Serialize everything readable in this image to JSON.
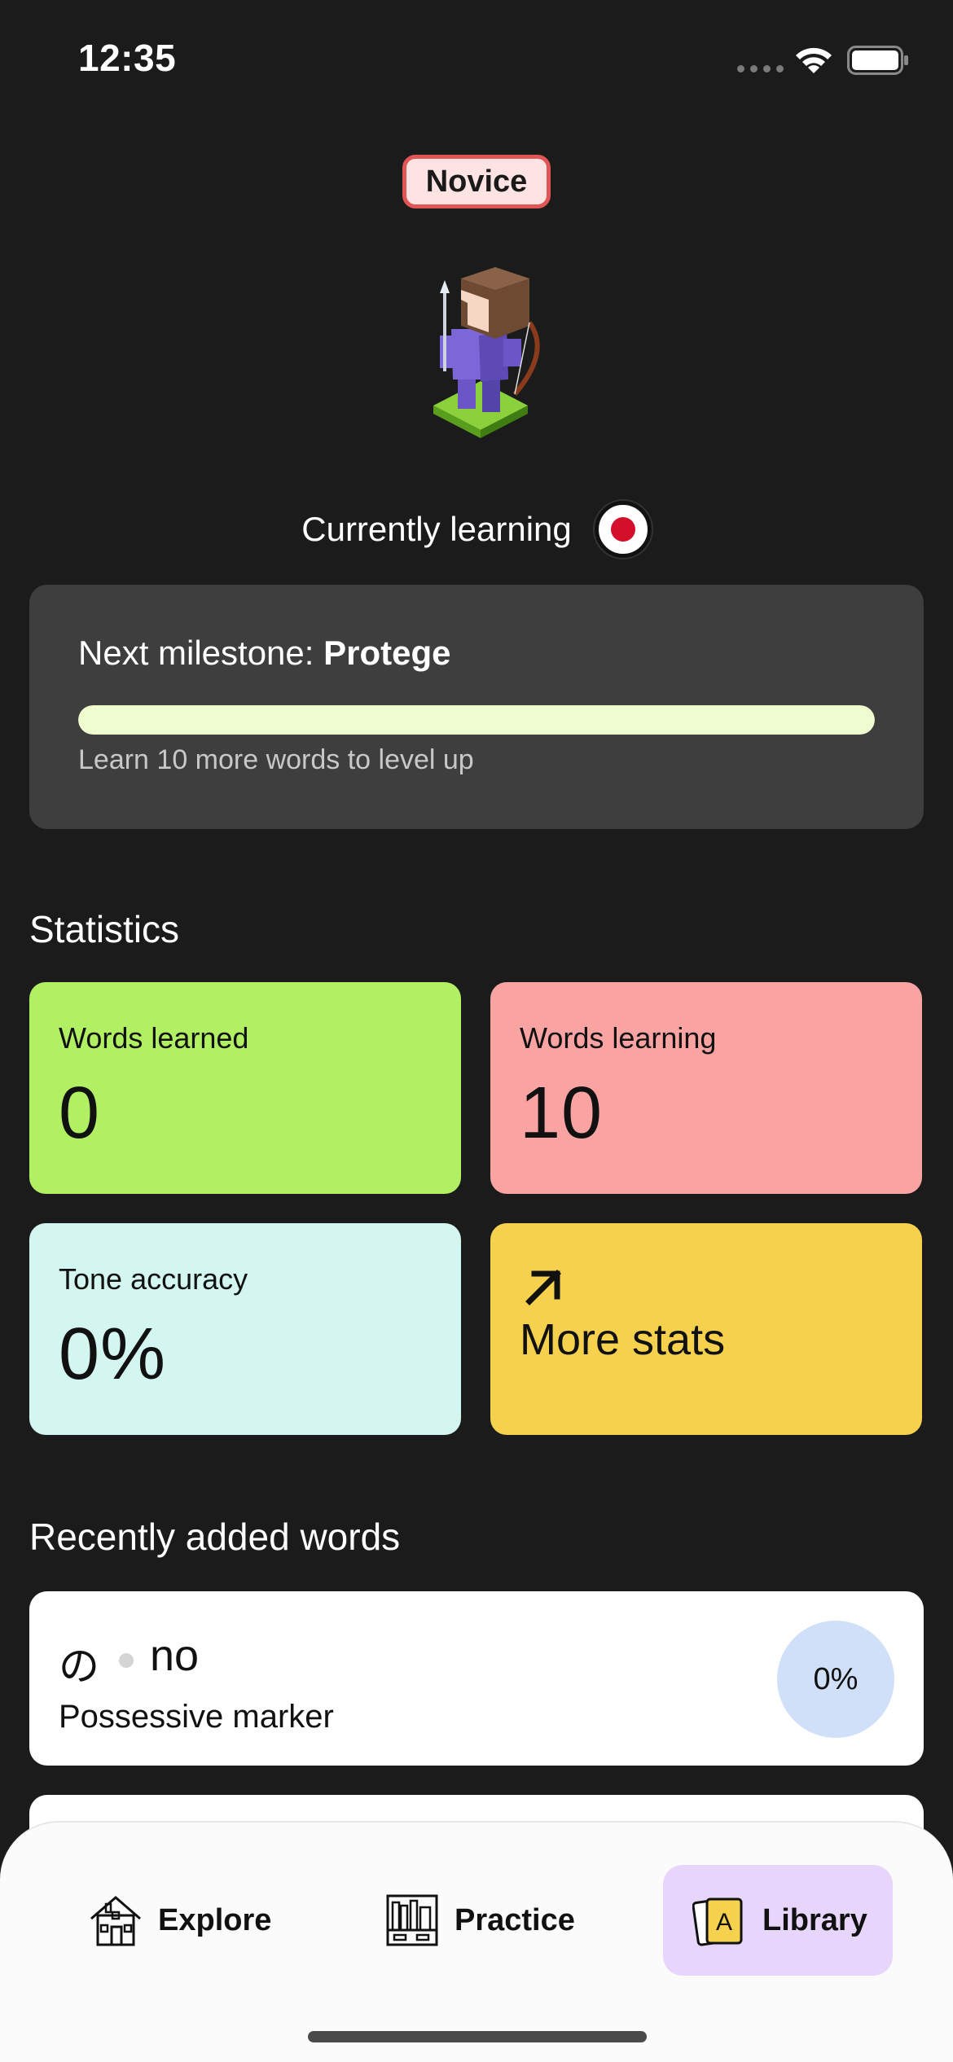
{
  "status_bar": {
    "time": "12:35"
  },
  "profile": {
    "level_badge": "Novice",
    "currently_learning_label": "Currently learning",
    "language_flag_icon": "japan-flag-icon"
  },
  "milestone": {
    "prefix": "Next milestone: ",
    "name": "Protege",
    "progress_fraction": 1.0,
    "hint": "Learn 10 more words to level up"
  },
  "statistics": {
    "title": "Statistics",
    "words_learned": {
      "label": "Words learned",
      "value": "0"
    },
    "words_learning": {
      "label": "Words learning",
      "value": "10"
    },
    "tone_accuracy": {
      "label": "Tone accuracy",
      "value": "0%"
    },
    "more_stats": {
      "label": "More stats",
      "icon": "arrow-up-right-icon"
    }
  },
  "recent_words": {
    "title": "Recently added words",
    "items": [
      {
        "kana": "の",
        "romaji": "no",
        "meaning": "Possessive marker",
        "progress": "0%"
      }
    ]
  },
  "bottom_nav": {
    "explore": {
      "label": "Explore",
      "icon": "house-icon"
    },
    "practice": {
      "label": "Practice",
      "icon": "bookshelf-icon"
    },
    "library": {
      "label": "Library",
      "icon": "flashcards-icon",
      "selected": true
    }
  },
  "colors": {
    "background": "#1b1b1b",
    "card_dark": "#3e3e3e",
    "progress_fill": "#eefcd0",
    "tile_green": "#b0f062",
    "tile_pink": "#f9a3a3",
    "tile_mint": "#d4f6f0",
    "tile_yellow": "#f5d14e",
    "library_highlight": "#e8d5fb",
    "badge_border": "#e05555"
  }
}
